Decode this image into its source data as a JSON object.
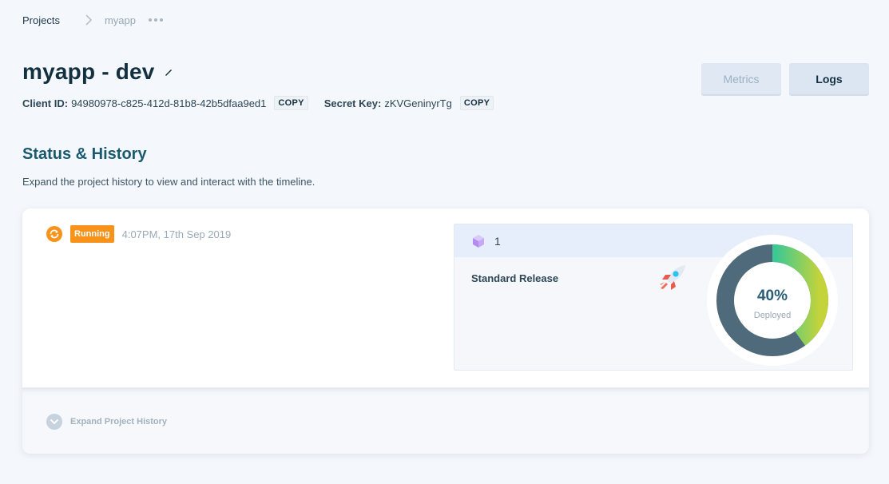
{
  "breadcrumb": {
    "root": "Projects",
    "current": "myapp"
  },
  "header": {
    "title": "myapp - dev",
    "client_id_label": "Client ID:",
    "client_id_value": "94980978-c825-412d-81b8-42b5dfaa9ed1",
    "secret_key_label": "Secret Key:",
    "secret_key_value": "zKVGeninyrTg",
    "copy_label": "COPY",
    "metrics_label": "Metrics",
    "logs_label": "Logs"
  },
  "section": {
    "title": "Status & History",
    "description": "Expand the project history to view and interact with the timeline."
  },
  "status": {
    "badge": "Running",
    "badge_color": "#f7931a",
    "timestamp": "4:07PM, 17th Sep 2019"
  },
  "release": {
    "number": "1",
    "name": "Standard Release",
    "deployed_percent": 40,
    "percent_text": "40%",
    "deployed_label": "Deployed"
  },
  "footer": {
    "expand_label": "Expand Project History"
  },
  "colors": {
    "accent": "#1b5a6e",
    "running": "#f7931a",
    "donut_track": "#4f6b7b"
  }
}
